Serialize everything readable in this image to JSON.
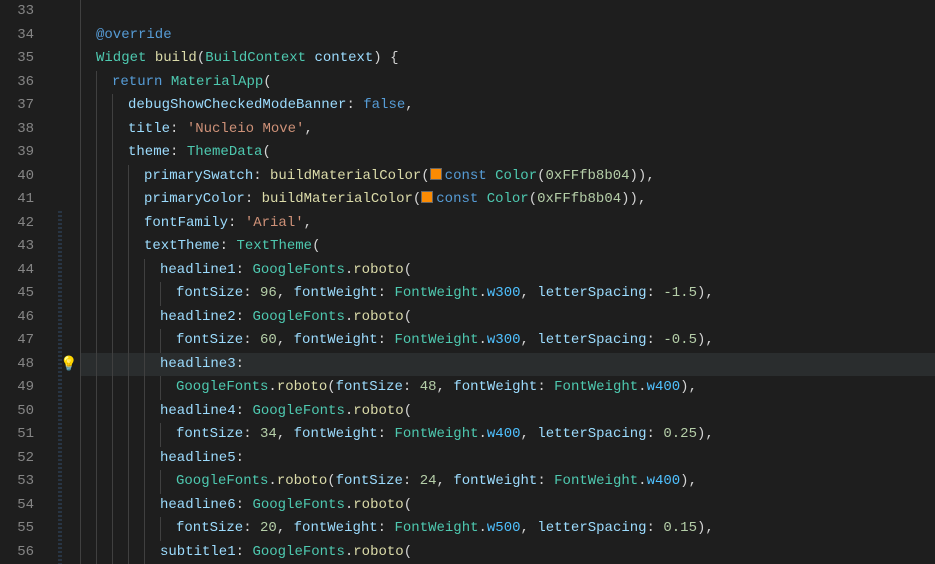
{
  "lineStart": 33,
  "highlightLine": 48,
  "bulbLine": 48,
  "colors": {
    "swatch": "#fb8b04",
    "bulb": "#ffcc00"
  },
  "tokens": {
    "override": "@override",
    "Widget": "Widget",
    "build": "build",
    "BuildContext": "BuildContext",
    "context": "context",
    "return": "return",
    "MaterialApp": "MaterialApp",
    "debugShowCheckedModeBanner": "debugShowCheckedModeBanner",
    "false": "false",
    "title": "title",
    "titleValue": "'Nucleio Move'",
    "theme": "theme",
    "ThemeData": "ThemeData",
    "primarySwatch": "primarySwatch",
    "primaryColor": "primaryColor",
    "buildMaterialColor": "buildMaterialColor",
    "const": "const",
    "Color": "Color",
    "colorHex": "0xFFfb8b04",
    "fontFamily": "fontFamily",
    "fontFamilyValue": "'Arial'",
    "textTheme": "textTheme",
    "TextTheme": "TextTheme",
    "headline1": "headline1",
    "headline2": "headline2",
    "headline3": "headline3",
    "headline4": "headline4",
    "headline5": "headline5",
    "headline6": "headline6",
    "subtitle1": "subtitle1",
    "GoogleFonts": "GoogleFonts",
    "roboto": "roboto",
    "fontSize": "fontSize",
    "fontWeight": "fontWeight",
    "FontWeight": "FontWeight",
    "w300": "w300",
    "w400": "w400",
    "w500": "w500",
    "letterSpacing": "letterSpacing",
    "fs96": "96",
    "fs60": "60",
    "fs48": "48",
    "fs34": "34",
    "fs24": "24",
    "fs20": "20",
    "lsNeg15": "-1.5",
    "lsNeg05": "-0.5",
    "ls025": "0.25",
    "ls015": "0.15"
  },
  "lineNumbers": [
    "33",
    "34",
    "35",
    "36",
    "37",
    "38",
    "39",
    "40",
    "41",
    "42",
    "43",
    "44",
    "45",
    "46",
    "47",
    "48",
    "49",
    "50",
    "51",
    "52",
    "53",
    "54",
    "55",
    "56"
  ]
}
